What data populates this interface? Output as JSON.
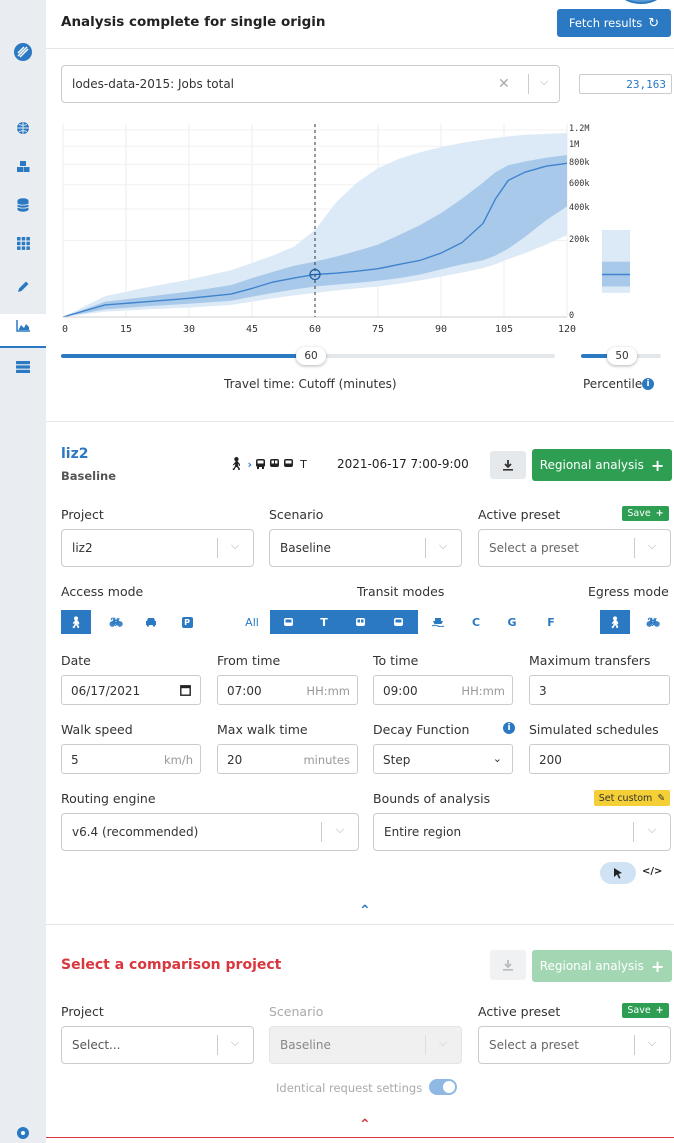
{
  "header": {
    "title": "Analysis complete for single origin",
    "fetch_label": "Fetch results"
  },
  "opportunity": {
    "dataset": "lodes-data-2015: Jobs total",
    "total": "23,163"
  },
  "chart_data": {
    "type": "area",
    "x_ticks": [
      "0",
      "15",
      "30",
      "45",
      "60",
      "75",
      "90",
      "105",
      "120"
    ],
    "y_ticks": [
      "1.2M",
      "1M",
      "800k",
      "600k",
      "400k",
      "200k",
      "0"
    ],
    "xlim": [
      0,
      120
    ],
    "y_scale": "sqrt",
    "ylim": [
      0,
      1200000
    ],
    "cutoff": 60,
    "median_line": {
      "x": [
        0,
        10,
        20,
        30,
        40,
        45,
        50,
        55,
        60,
        65,
        70,
        75,
        80,
        85,
        90,
        95,
        100,
        103,
        106,
        110,
        115,
        120
      ],
      "y": [
        0,
        5000,
        8000,
        12000,
        18000,
        28000,
        42000,
        52000,
        62000,
        66000,
        72000,
        80000,
        95000,
        110000,
        140000,
        190000,
        300000,
        480000,
        640000,
        720000,
        780000,
        810000
      ]
    },
    "band_inner": {
      "lower": [
        0,
        2000,
        4000,
        6000,
        9000,
        14000,
        20000,
        26000,
        32000,
        36000,
        40000,
        45000,
        52000,
        62000,
        78000,
        95000,
        110000,
        130000,
        160000,
        220000,
        320000,
        420000
      ],
      "upper": [
        0,
        8000,
        14000,
        22000,
        35000,
        52000,
        70000,
        90000,
        105000,
        125000,
        150000,
        180000,
        230000,
        290000,
        370000,
        480000,
        620000,
        720000,
        790000,
        830000,
        870000,
        900000
      ]
    },
    "band_outer": {
      "lower": [
        0,
        1000,
        2000,
        3000,
        5000,
        8000,
        12000,
        16000,
        20000,
        24000,
        28000,
        32000,
        38000,
        46000,
        56000,
        68000,
        82000,
        96000,
        115000,
        140000,
        180000,
        230000
      ],
      "upper": [
        0,
        15000,
        30000,
        48000,
        75000,
        100000,
        130000,
        170000,
        260000,
        450000,
        620000,
        760000,
        860000,
        930000,
        990000,
        1040000,
        1080000,
        1100000,
        1120000,
        1140000,
        1150000,
        1160000
      ]
    },
    "cutoff_marker_y": 62000,
    "colors": {
      "line": "#3f83cc",
      "band_inner": "#a9c9ea",
      "band_outer": "#dce9f6"
    }
  },
  "sliders": {
    "cutoff_value": "60",
    "cutoff_label": "Travel time: Cutoff (minutes)",
    "percentile_value": "50",
    "percentile_label": "Percentile"
  },
  "primary": {
    "project_name": "liz2",
    "scenario_name": "Baseline",
    "mode_summary_text": "T",
    "datetime_summary": "2021-06-17  7:00-9:00",
    "regional_label": "Regional analysis",
    "labels": {
      "project": "Project",
      "scenario": "Scenario",
      "preset": "Active preset",
      "save": "Save"
    },
    "project_value": "liz2",
    "scenario_value": "Baseline",
    "preset_placeholder": "Select a preset",
    "modes": {
      "access_label": "Access mode",
      "transit_label": "Transit modes",
      "egress_label": "Egress mode",
      "transit_all": "All",
      "transit_tram": "T",
      "transit_cable": "C",
      "transit_gondola": "G",
      "transit_funicular": "F"
    },
    "fields": {
      "date_label": "Date",
      "date_value": "06/17/2021",
      "from_label": "From time",
      "from_value": "07:00",
      "from_hint": "HH:mm",
      "to_label": "To time",
      "to_value": "09:00",
      "to_hint": "HH:mm",
      "transfers_label": "Maximum transfers",
      "transfers_value": "3",
      "walk_speed_label": "Walk speed",
      "walk_speed_value": "5",
      "walk_speed_unit": "km/h",
      "walk_time_label": "Max walk time",
      "walk_time_value": "20",
      "walk_time_unit": "minutes",
      "decay_label": "Decay Function",
      "decay_value": "Step",
      "schedules_label": "Simulated schedules",
      "schedules_value": "200",
      "engine_label": "Routing engine",
      "engine_value": "v6.4 (recommended)",
      "bounds_label": "Bounds of analysis",
      "bounds_value": "Entire region",
      "set_custom": "Set custom"
    }
  },
  "comparison": {
    "title": "Select a comparison project",
    "regional_label": "Regional analysis",
    "labels": {
      "project": "Project",
      "scenario": "Scenario",
      "preset": "Active preset",
      "save": "Save"
    },
    "project_placeholder": "Select...",
    "scenario_value": "Baseline",
    "preset_placeholder": "Select a preset",
    "identical_label": "Identical request settings"
  }
}
